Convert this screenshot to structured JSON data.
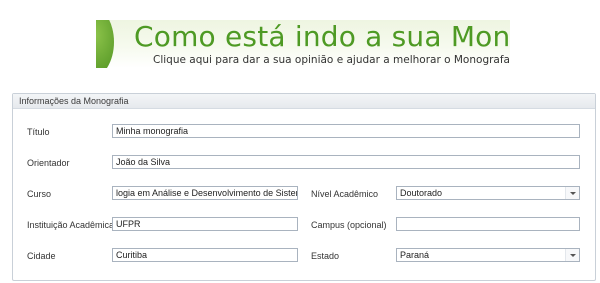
{
  "banner": {
    "title": "Como está indo a sua Monogr",
    "subtitle": "Clique aqui para dar a sua opinião e ajudar a melhorar o Monografa"
  },
  "group": {
    "title": "Informações da Monografia"
  },
  "form": {
    "titulo": {
      "label": "Título",
      "value": "Minha monografia"
    },
    "orientador": {
      "label": "Orientador",
      "value": "João da Silva"
    },
    "curso": {
      "label": "Curso",
      "value": "logia em Análise e Desenvolvimento de Sistemas"
    },
    "nivel_academico": {
      "label": "Nível Acadêmico",
      "value": "Doutorado"
    },
    "instituicao": {
      "label": "Instituição Acadêmica",
      "value": "UFPR"
    },
    "campus": {
      "label": "Campus (opcional)",
      "value": ""
    },
    "cidade": {
      "label": "Cidade",
      "value": "Curitiba"
    },
    "estado": {
      "label": "Estado",
      "value": "Paraná"
    }
  },
  "colors": {
    "banner_green": "#4e9a24",
    "banner_background": "#eef5e1",
    "field_border": "#a9b3bf"
  }
}
